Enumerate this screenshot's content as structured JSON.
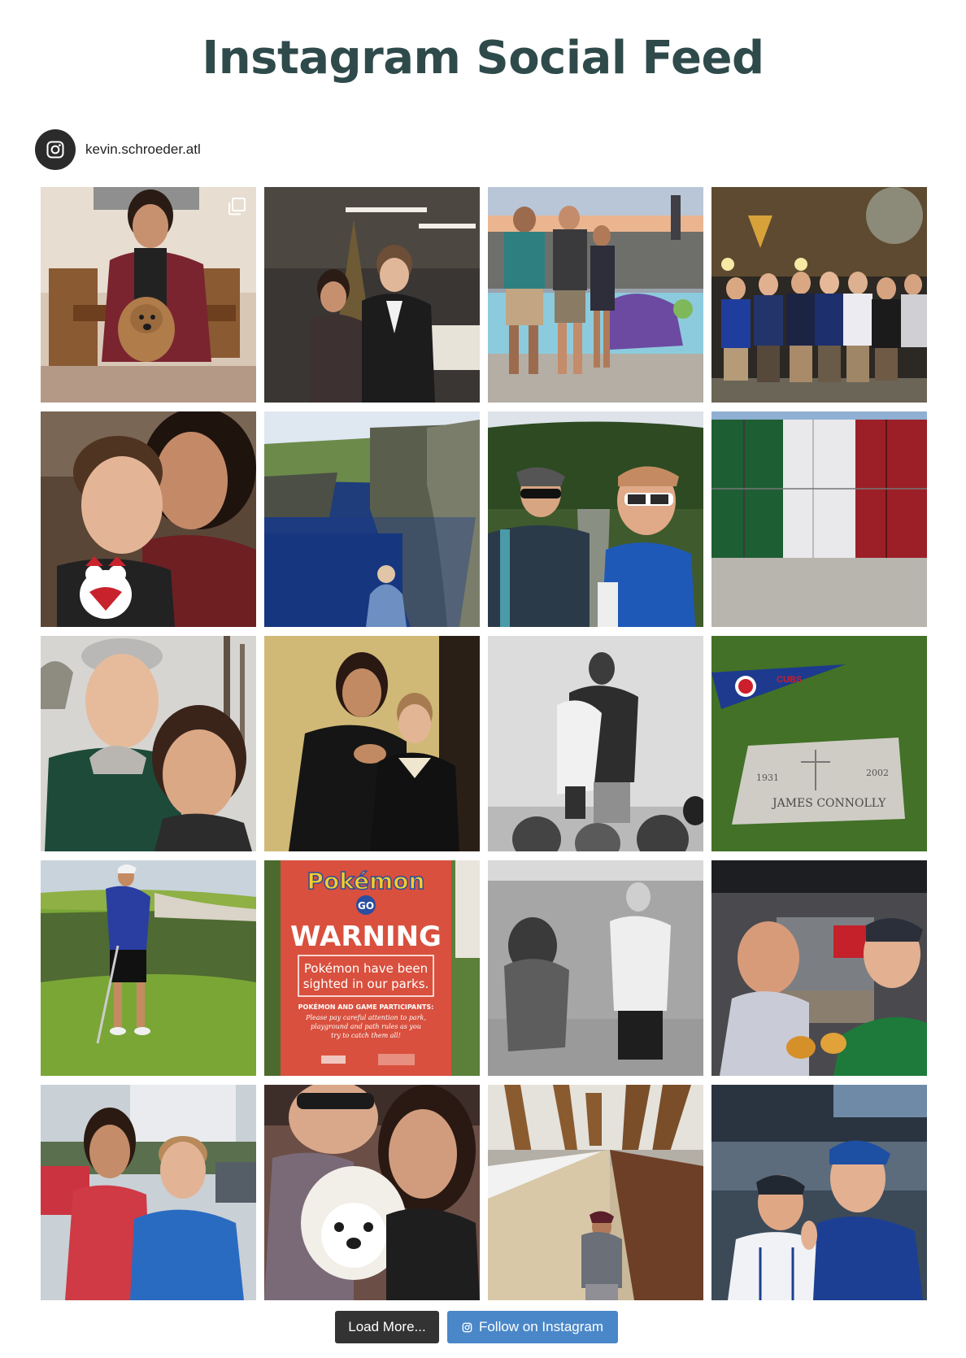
{
  "header": {
    "title": "Instagram Social Feed"
  },
  "profile": {
    "username": "kevin.schroeder.atl",
    "icon": "instagram-icon"
  },
  "feed": {
    "posts": [
      {
        "name": "post-couple-with-dog-dining-room",
        "multi": true
      },
      {
        "name": "post-couple-christmas-tree"
      },
      {
        "name": "post-three-friends-mural-skyline"
      },
      {
        "name": "post-group-outside-bar"
      },
      {
        "name": "post-couple-selfie-ornament"
      },
      {
        "name": "post-cliffs-ocean"
      },
      {
        "name": "post-hiking-selfie-waterfall"
      },
      {
        "name": "post-italian-flag-wall"
      },
      {
        "name": "post-couple-selfie-trees"
      },
      {
        "name": "post-couple-dark-room"
      },
      {
        "name": "post-hug-black-white"
      },
      {
        "name": "post-cubs-pennant-grave"
      },
      {
        "name": "post-golf-swing"
      },
      {
        "name": "post-pokemon-go-warning-sign",
        "sign": {
          "brand": "Pokémon",
          "sub": "GO",
          "headline": "WARNING",
          "line1": "Pokémon have been",
          "line2": "sighted in our parks.",
          "note_title": "POKÉMON AND GAME PARTICIPANTS:",
          "note1": "Please pay careful attention to park,",
          "note2": "playground and path rules as you",
          "note3": "try to catch them all!"
        }
      },
      {
        "name": "post-black-white-proposal"
      },
      {
        "name": "post-friends-bar-selfie"
      },
      {
        "name": "post-couple-selfie-car"
      },
      {
        "name": "post-couple-with-puppy"
      },
      {
        "name": "post-bridge-walkway"
      },
      {
        "name": "post-baseball-stadium-selfie"
      }
    ],
    "pennant_text": "CUBS",
    "grave": {
      "name": "JAMES CONNOLLY",
      "year_start": "1931",
      "year_end": "2002"
    },
    "flag_colors": [
      "#2f7a3e",
      "#f1f1f1",
      "#c2272d"
    ]
  },
  "actions": {
    "load_more": "Load More...",
    "follow": "Follow on Instagram"
  },
  "colors": {
    "title": "#2f4a4a",
    "load_button": "#333333",
    "follow_button": "#4a87c9",
    "avatar": "#2b2b2b"
  }
}
